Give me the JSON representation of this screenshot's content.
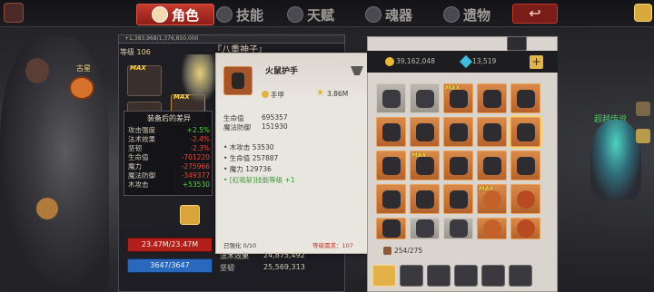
{
  "tabs": [
    {
      "label": "角色",
      "active": true
    },
    {
      "label": "技能"
    },
    {
      "label": "天赋"
    },
    {
      "label": "魂器"
    },
    {
      "label": "遗物"
    }
  ],
  "character": {
    "exp_text": "+1,383,968/1,376,850,000",
    "level_label": "等级",
    "level": "106",
    "name": "『八重神子』",
    "nearby_label": "古星",
    "hp_text": "23.47M/23.47M",
    "mp_text": "3647/3647",
    "under_stats": [
      {
        "label": "法术效果",
        "value": "24,875,492"
      },
      {
        "label": "坚韧",
        "value": "25,569,313"
      }
    ],
    "equip_max_tags": [
      "MAX",
      "MAX"
    ]
  },
  "compare": {
    "title": "装备后的差异",
    "rows": [
      {
        "label": "攻击强度",
        "value": "+2.5%",
        "dir": "up"
      },
      {
        "label": "法术效果",
        "value": "-2.4%",
        "dir": "down"
      },
      {
        "label": "坚韧",
        "value": "-2.3%",
        "dir": "down"
      },
      {
        "label": "生命值",
        "value": "-701220",
        "dir": "down"
      },
      {
        "label": "魔力",
        "value": "-275966",
        "dir": "down"
      },
      {
        "label": "魔法防御",
        "value": "-349377",
        "dir": "down"
      },
      {
        "label": "木攻击",
        "value": "+53530",
        "dir": "up"
      }
    ]
  },
  "tooltip": {
    "name": "火鼠护手",
    "type": "手甲",
    "power": "3.86M",
    "base_stats": [
      {
        "label": "生命值",
        "value": "695357"
      },
      {
        "label": "魔法防御",
        "value": "151930"
      }
    ],
    "attrs": [
      "• 木攻击 53530",
      "• 生命值 257887",
      "• 魔力 129736"
    ],
    "skill": "• [虹吸斩]技能等级 +1",
    "footer_left": "已强化 0/10",
    "footer_right": "等级需求：107"
  },
  "inventory": {
    "gold": "39,162,048",
    "gems": "13,519",
    "add_label": "+",
    "count_current": "254",
    "count_max": "275",
    "max_label": "MAX"
  },
  "right_hero": {
    "name": "超越传说"
  },
  "colors": {
    "accent_red": "#c43a2e",
    "hp_red": "#b3201b",
    "mp_blue": "#2a68bd",
    "up_green": "#58d34e",
    "down_red": "#e5473a",
    "rarity_orange": "#d98a4a",
    "rarity_gray": "#bcb7ae"
  }
}
